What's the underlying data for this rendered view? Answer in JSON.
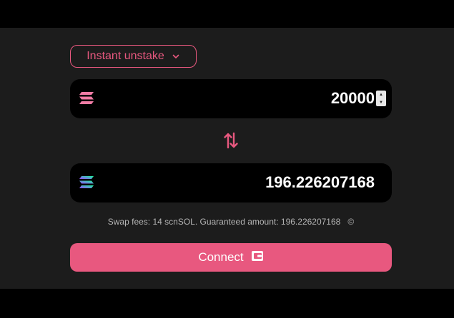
{
  "mode_select": {
    "label": "Instant unstake",
    "icon": "chevron-down-icon"
  },
  "from": {
    "token_icon": "sol-icon",
    "token_color": "#f07ca5",
    "amount": "20000"
  },
  "swap_icon": "swap-arrows-icon",
  "to": {
    "token_icon": "solana-gradient-icon",
    "amount": "196.226207168"
  },
  "fees": {
    "text": "Swap fees: 14 scnSOL. Guaranteed amount: 196.226207168",
    "info_icon": "copyright-icon",
    "info_glyph": "©"
  },
  "connect": {
    "label": "Connect",
    "icon": "wallet-icon"
  },
  "colors": {
    "accent": "#e8587f",
    "background": "#1c1c1c",
    "box": "#000000",
    "fee_text": "#b5b5b5"
  }
}
